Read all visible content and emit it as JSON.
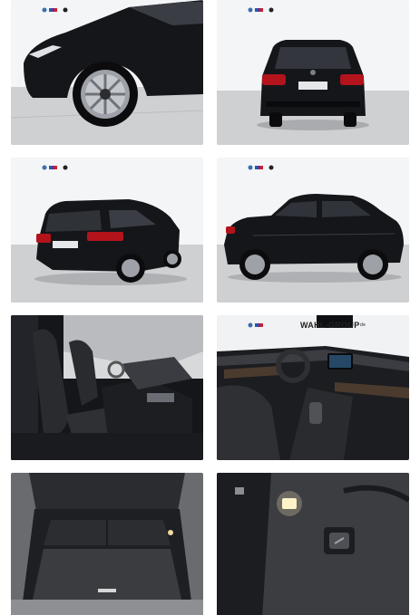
{
  "gallery": {
    "images": [
      {
        "name": "front-wheel-closeup"
      },
      {
        "name": "rear-view"
      },
      {
        "name": "rear-three-quarter-view"
      },
      {
        "name": "side-profile-view"
      },
      {
        "name": "front-seats-interior"
      },
      {
        "name": "dashboard-interior"
      },
      {
        "name": "trunk-open-view"
      },
      {
        "name": "trunk-side-compartment"
      }
    ],
    "dealer_watermark": "WAHL-GROUP",
    "dealer_watermark_suffix": "de"
  },
  "colors": {
    "car_body": "#15161a",
    "showroom_wall": "#f4f5f6",
    "showroom_floor": "#cfd0d2",
    "interior_leather": "#2a2b2e",
    "trunk_carpet": "#3b3c40",
    "taillight": "#b3131b"
  }
}
